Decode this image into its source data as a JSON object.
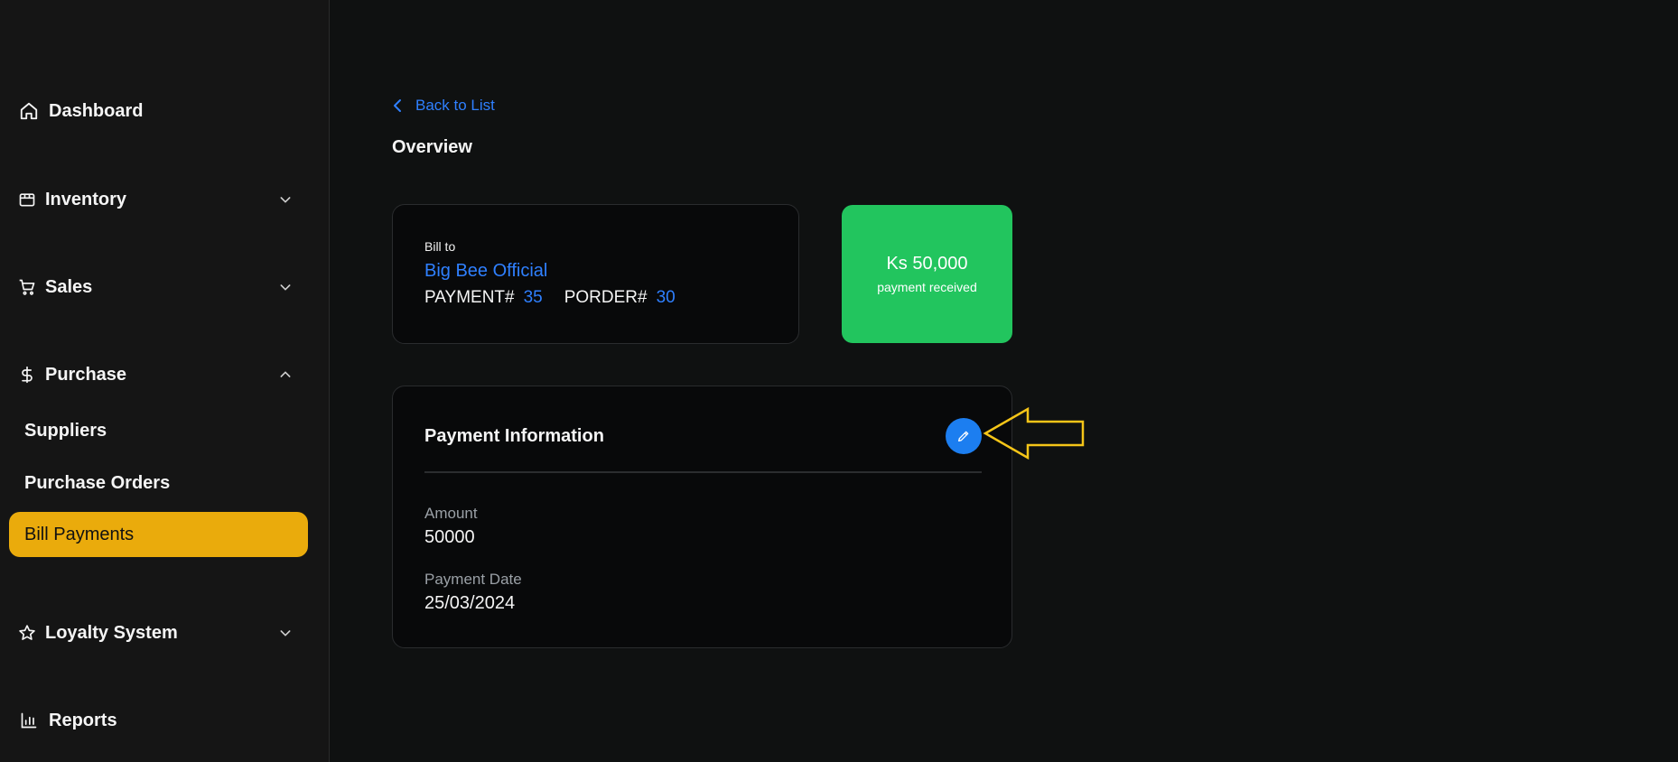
{
  "sidebar": {
    "items": [
      {
        "label": "Dashboard",
        "icon": "home-icon"
      },
      {
        "label": "Inventory",
        "icon": "box-icon"
      },
      {
        "label": "Sales",
        "icon": "cart-icon"
      },
      {
        "label": "Purchase",
        "icon": "dollar-icon"
      },
      {
        "label": "Loyalty System",
        "icon": "star-icon"
      },
      {
        "label": "Reports",
        "icon": "bar-chart-icon"
      }
    ],
    "purchase_sub": [
      {
        "label": "Suppliers"
      },
      {
        "label": "Purchase Orders"
      },
      {
        "label": "Bill Payments",
        "active": true
      }
    ]
  },
  "main": {
    "back_label": "Back to List",
    "title": "Overview",
    "bill": {
      "label": "Bill to",
      "name": "Big Bee Official",
      "payment_label": "PAYMENT#",
      "payment_no": "35",
      "porder_label": "PORDER#",
      "porder_no": "30"
    },
    "received": {
      "amount": "Ks 50,000",
      "label": "payment received"
    },
    "payment_info": {
      "title": "Payment Information",
      "amount_label": "Amount",
      "amount_value": "50000",
      "date_label": "Payment Date",
      "date_value": "25/03/2024"
    }
  },
  "colors": {
    "accent_blue": "#2f80ff",
    "active_yellow": "#eaab0c",
    "success_green": "#22c55e",
    "annotation_yellow": "#f5c518"
  }
}
